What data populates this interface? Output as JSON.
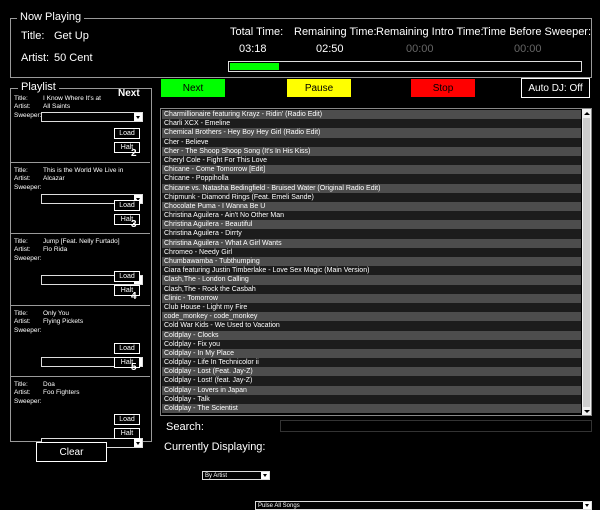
{
  "now_playing": {
    "group_label": "Now Playing",
    "title_label": "Title:",
    "title_value": "Get Up",
    "artist_label": "Artist:",
    "artist_value": "50 Cent",
    "total_time_label": "Total Time:",
    "total_time_value": "03:18",
    "remaining_time_label": "Remaining Time:",
    "remaining_time_value": "02:50",
    "remaining_intro_label": "Remaining Intro Time:",
    "remaining_intro_value": "00:00",
    "before_sweeper_label": "Time Before Sweeper:",
    "before_sweeper_value": "00:00",
    "progress_fraction": 0.14,
    "progress_color": "#00ff00"
  },
  "controls": {
    "next_label": "Next",
    "next_color": "#00ff00",
    "pause_label": "Pause",
    "pause_color": "#ffff00",
    "stop_label": "Stop",
    "stop_color": "#ff0000",
    "auto_dj_label": "Auto DJ: Off"
  },
  "playlist": {
    "group_label": "Playlist",
    "next_label": "Next",
    "title_field_label": "Title:",
    "artist_field_label": "Artist:",
    "sweeper_label": "Sweeper:",
    "load_label": "Load",
    "halt_label": "Halt",
    "clear_label": "Clear",
    "slots": [
      {
        "number": "1",
        "title": "I Know Where It's at",
        "artist": "All Saints"
      },
      {
        "number": "2",
        "title": "This is the World We Live in",
        "artist": "Alcazar"
      },
      {
        "number": "3",
        "title": "Jump [Feat. Nelly Furtado]",
        "artist": "Flo Rida"
      },
      {
        "number": "4",
        "title": "Only You",
        "artist": "Flying Pickets"
      },
      {
        "number": "5",
        "title": "Doa",
        "artist": "Foo Fighters"
      }
    ]
  },
  "songs": [
    "Charmillionaire featuring Krayz - Ridin' (Radio Edit)",
    "Charli XCX - Emeline",
    "Chemical Brothers - Hey Boy Hey Girl (Radio Edit)",
    "Cher - Believe",
    "Cher - The Shoop Shoop Song (It's In His Kiss)",
    "Cheryl Cole - Fight For This Love",
    "Chicane - Come Tomorrow [Edit]",
    "Chicane - Poppiholla",
    "Chicane vs. Natasha Bedingfield - Bruised Water (Original Radio Edit)",
    "Chipmunk - Diamond Rings (Feat. Emeli Sande)",
    "Chocolate Puma - I Wanna Be U",
    "Christina Aguilera - Ain't No Other Man",
    "Christina Aguilera - Beautiful",
    "Christina Aguilera - Dirrty",
    "Christina Aguilera - What A Girl Wants",
    "Chromeo - Needy Girl",
    "Chumbawamba - Tubthumping",
    "Ciara featuring Justin Timberlake - Love Sex Magic (Main Version)",
    "Clash,The - London Calling",
    "Clash,The - Rock the Casbah",
    "Clinic - Tomorrow",
    "Club House - Light my Fire",
    "code_monkey - code_monkey",
    "Cold War Kids - We Used to Vacation",
    "Coldplay - Clocks",
    "Coldplay - Fix you",
    "Coldplay - In My Place",
    "Coldplay - Life In Technicolor ii",
    "Coldplay - Lost (Feat. Jay-Z)",
    "Coldplay - Lost! (feat. Jay-Z)",
    "Coldplay - Lovers in Japan",
    "Coldplay - Talk",
    "Coldplay - The Scientist"
  ],
  "search": {
    "label": "Search:",
    "mode_value": "By Artist",
    "query_value": ""
  },
  "displaying": {
    "label": "Currently Displaying:",
    "value": "Pulse All Songs"
  }
}
